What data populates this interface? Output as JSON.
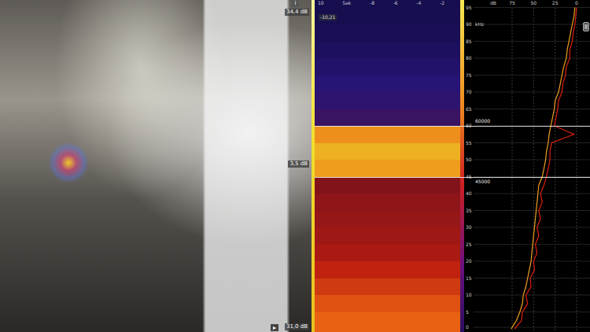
{
  "camera": {
    "info_icon": "i",
    "scale_max": "34,4 dB",
    "scale_marker": "3,5 dB",
    "scale_min": "31,0 dB",
    "play_icon": "▸"
  },
  "spectrogram": {
    "time_ticks": [
      "10",
      "Sek",
      "-8",
      "-6",
      "-4",
      "-2"
    ],
    "readout": "-10,21",
    "bin_khz": 5,
    "levels": [
      0.82,
      0.78,
      0.72,
      0.66,
      0.6,
      0.57,
      0.55,
      0.53,
      0.5,
      0.92,
      0.95,
      0.9,
      0.3,
      0.27,
      0.24,
      0.2,
      0.16,
      0.13,
      0.1
    ]
  },
  "spectrum": {
    "freq_unit": "kHz",
    "freq_ticks": [
      "0",
      "5",
      "10",
      "15",
      "20",
      "25",
      "30",
      "35",
      "40",
      "45",
      "50",
      "55",
      "60",
      "65",
      "70",
      "75",
      "80",
      "85",
      "90",
      "95"
    ],
    "level_unit": "dB",
    "level_ticks": [
      "75",
      "50",
      "25",
      "0"
    ],
    "step_khz": 2.5,
    "series": [
      {
        "color": "#f0a020",
        "values": [
          76,
          70,
          66,
          63,
          62,
          59,
          57,
          55,
          53,
          52,
          51,
          50,
          49,
          48,
          47,
          46,
          45,
          44,
          40,
          38,
          36,
          35,
          33,
          32,
          30,
          28,
          26,
          25,
          21,
          19,
          17,
          15,
          12,
          11,
          9,
          7,
          5,
          3,
          2
        ]
      },
      {
        "color": "#e02010",
        "values": [
          72,
          64,
          63,
          57,
          59,
          53,
          54,
          49,
          50,
          46,
          48,
          44,
          46,
          42,
          44,
          40,
          42,
          38,
          35,
          33,
          31,
          31,
          29,
          3,
          26,
          24,
          22,
          21,
          17,
          16,
          13,
          12,
          8,
          8,
          5,
          4,
          2,
          1,
          0
        ]
      }
    ]
  },
  "band": {
    "selected": true,
    "high_khz": 60,
    "low_khz": 45,
    "high_label": "60000",
    "low_label": "45000"
  }
}
